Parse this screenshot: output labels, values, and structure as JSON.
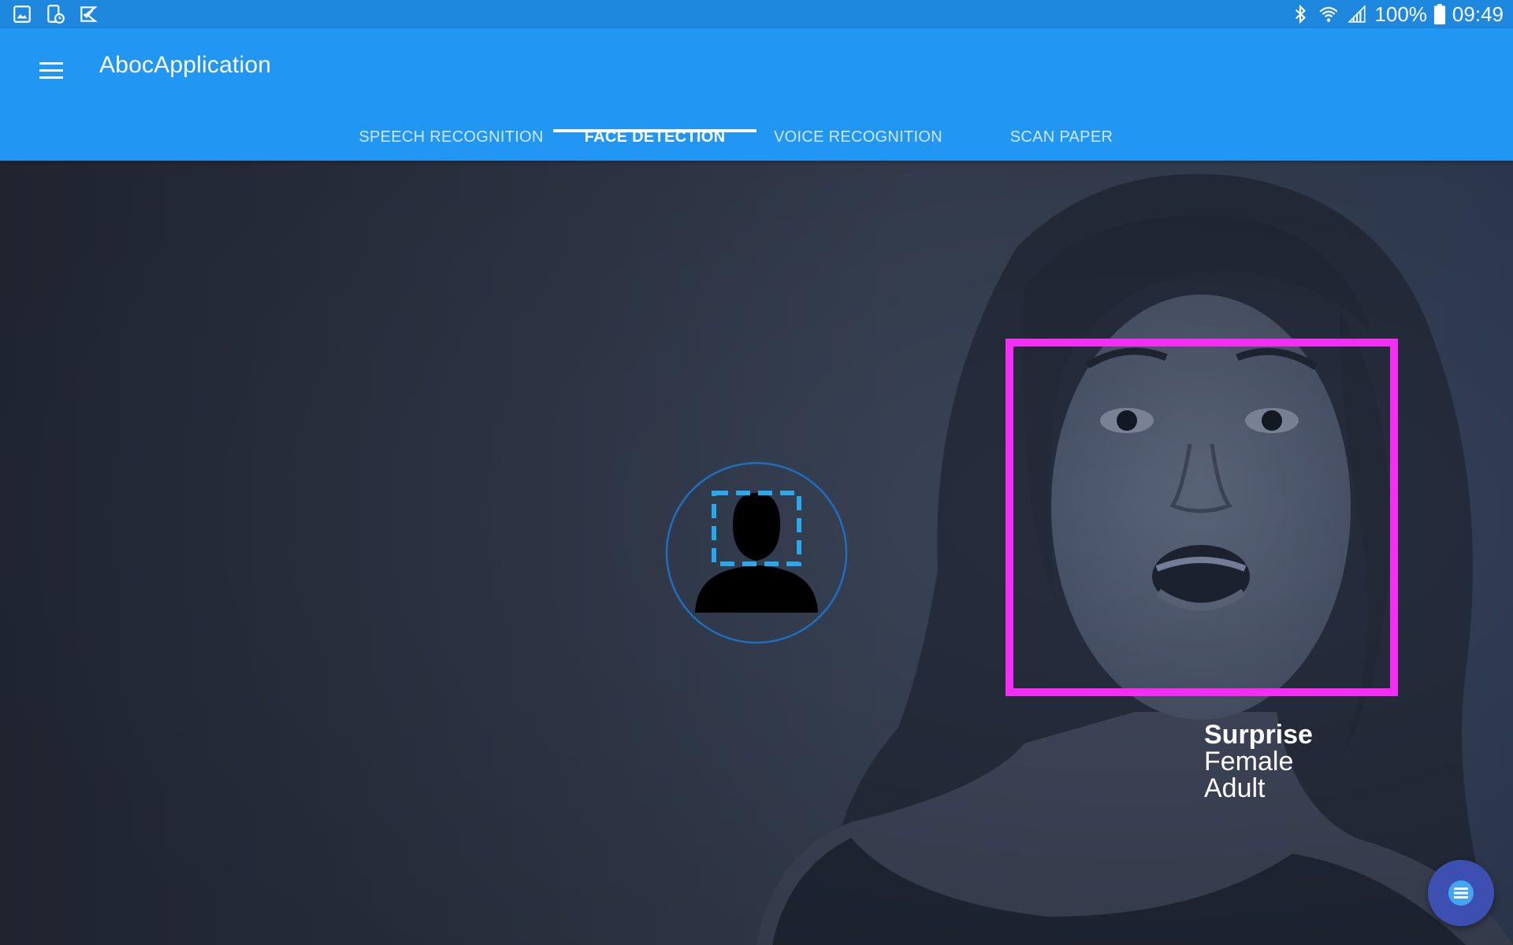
{
  "status_bar": {
    "battery": "100%",
    "time": "09:49",
    "icons": [
      "gallery-icon",
      "device-clock-icon",
      "task-check-icon",
      "bluetooth-icon",
      "wifi-icon",
      "signal-icon",
      "battery-icon"
    ]
  },
  "app_bar": {
    "title": "AbocApplication",
    "menu_icon": "hamburger-menu-icon",
    "tabs": [
      {
        "label": "SPEECH RECOGNITION",
        "active": false
      },
      {
        "label": "FACE DETECTION",
        "active": true
      },
      {
        "label": "VOICE RECOGNITION",
        "active": false
      },
      {
        "label": "SCAN PAPER",
        "active": false
      }
    ]
  },
  "face_detection": {
    "emotion": "Surprise",
    "gender": "Female",
    "age_group": "Adult",
    "box_color": "#f42ef4"
  },
  "colors": {
    "status_bar": "#1e87de",
    "app_bar": "#2196f3",
    "fab": "#3d4fb0",
    "accent": "#29a8ee"
  },
  "fab": {
    "icon": "list-menu-icon"
  }
}
